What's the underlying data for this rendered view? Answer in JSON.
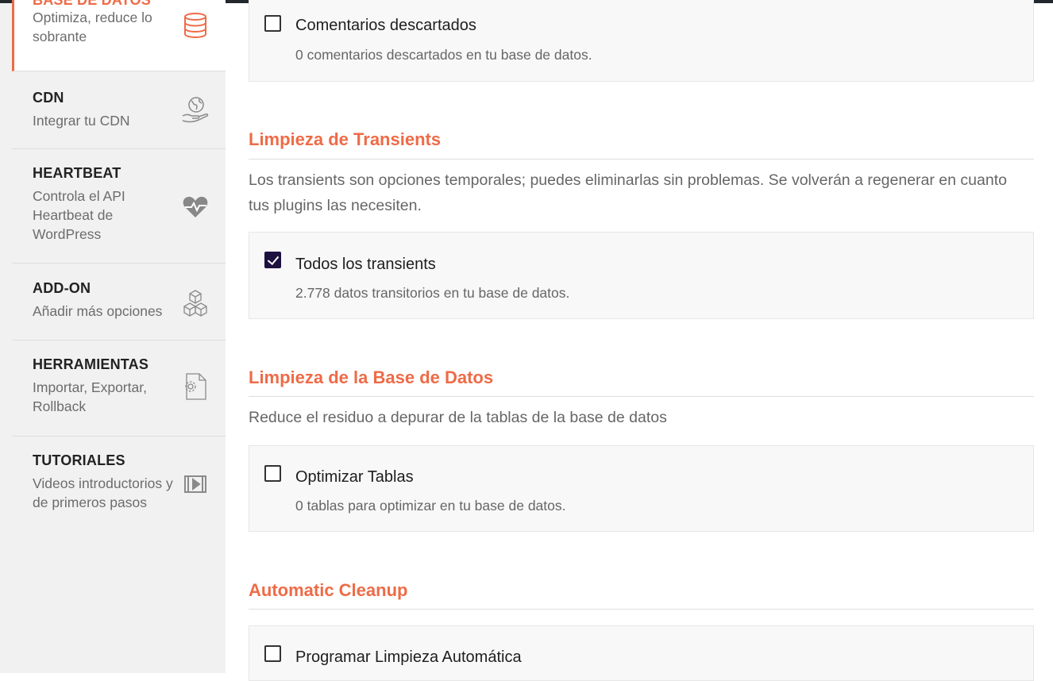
{
  "sidebar": {
    "items": [
      {
        "title": "BASE DE DATOS",
        "desc": "Optimiza, reduce lo sobrante",
        "icon": "database-icon",
        "active": true
      },
      {
        "title": "CDN",
        "desc": "Integrar tu CDN",
        "icon": "globe-hand-icon"
      },
      {
        "title": "HEARTBEAT",
        "desc": "Controla el API Heartbeat de WordPress",
        "icon": "heartbeat-icon"
      },
      {
        "title": "ADD-ON",
        "desc": "Añadir más opciones",
        "icon": "cubes-icon"
      },
      {
        "title": "HERRAMIENTAS",
        "desc": "Importar, Exportar, Rollback",
        "icon": "file-gear-icon"
      },
      {
        "title": "TUTORIALES",
        "desc": "Videos introductorios y de primeros pasos",
        "icon": "video-icon"
      }
    ]
  },
  "main": {
    "spam_card": {
      "label": "Comentarios descartados",
      "desc": "0 comentarios descartados en tu base de datos.",
      "checked": false
    },
    "transients": {
      "title": "Limpieza de Transients",
      "desc": "Los transients son opciones temporales; puedes eliminarlas sin problemas. Se volverán a regenerar en cuanto tus plugins las necesiten.",
      "option": {
        "label": "Todos los transients",
        "desc": "2.778 datos transitorios en tu base de datos.",
        "checked": true
      }
    },
    "database": {
      "title": "Limpieza de la Base de Datos",
      "desc": "Reduce el residuo a depurar de la tablas de la base de datos",
      "option": {
        "label": "Optimizar Tablas",
        "desc": "0 tablas para optimizar en tu base de datos.",
        "checked": false
      }
    },
    "automatic": {
      "title": "Automatic Cleanup",
      "option": {
        "label": "Programar Limpieza Automática",
        "checked": false
      }
    }
  },
  "colors": {
    "accent": "#ee6b47",
    "checkbox_checked": "#1d1140",
    "sidebar_bg": "#f1f1f1",
    "card_bg": "#f8f8f9"
  }
}
